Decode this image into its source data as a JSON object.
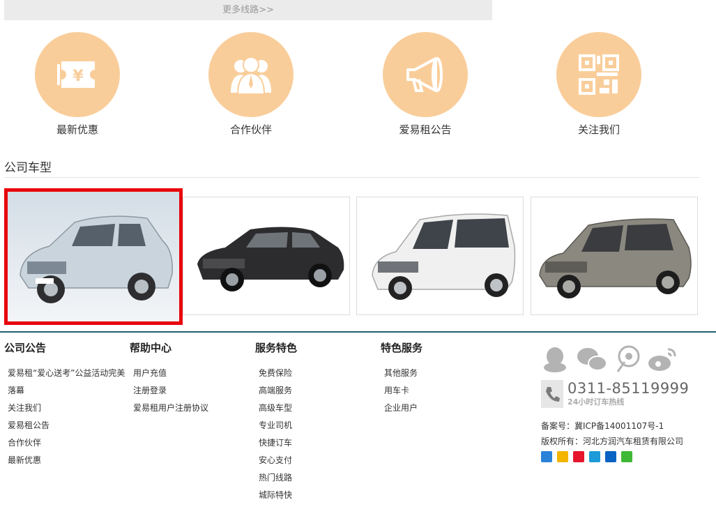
{
  "top_bar": {
    "more_routes_label": "更多线路>>"
  },
  "features": [
    {
      "label": "最新优惠",
      "icon": "coupon-icon"
    },
    {
      "label": "合作伙伴",
      "icon": "partners-icon"
    },
    {
      "label": "爱易租公告",
      "icon": "megaphone-icon"
    },
    {
      "label": "关注我们",
      "icon": "qrcode-icon"
    }
  ],
  "section": {
    "title": "公司车型"
  },
  "cars": [
    {
      "name": "e6",
      "color": "#c9d4dc",
      "selected": true
    },
    {
      "name": "sedan",
      "color": "#2c2c2e",
      "selected": false
    },
    {
      "name": "mpv-white",
      "color": "#f0f0f0",
      "selected": false
    },
    {
      "name": "mpv-grey",
      "color": "#8a887f",
      "selected": false
    }
  ],
  "footer": {
    "columns": [
      {
        "title": "公司公告",
        "items": [
          "爱易租“爱心送考”公益活动完美落幕",
          "关注我们",
          "爱易租公告",
          "合作伙伴",
          "最新优惠"
        ]
      },
      {
        "title": "帮助中心",
        "items": [
          "用户充值",
          "注册登录",
          "爱易租用户注册协议"
        ]
      },
      {
        "title": "服务特色",
        "items": [
          "免费保险",
          "高端服务",
          "高级车型",
          "专业司机",
          "快捷订车",
          "安心支付",
          "热门线路",
          "城际特快"
        ]
      },
      {
        "title": "特色服务",
        "items": [
          "其他服务",
          "用车卡",
          "企业用户"
        ]
      }
    ],
    "contact": {
      "phone": "0311-85119999",
      "hotline": "24小时订车热线",
      "icp": "备案号：冀ICP备14001107号-1",
      "copyright": "版权所有：河北方润汽车租赁有限公司"
    },
    "social_icons": [
      "qq-icon",
      "wechat-icon",
      "weibo-tencent-icon",
      "weibo-sina-icon"
    ],
    "share_icons": [
      "share-more-icon",
      "qzone-icon",
      "sina-icon",
      "tencent-icon",
      "renren-icon",
      "wechat-share-icon"
    ]
  },
  "colors": {
    "accent_circle": "#f9cd9a",
    "highlight_red": "#e8070b",
    "footer_rule": "#1f5f6f"
  }
}
